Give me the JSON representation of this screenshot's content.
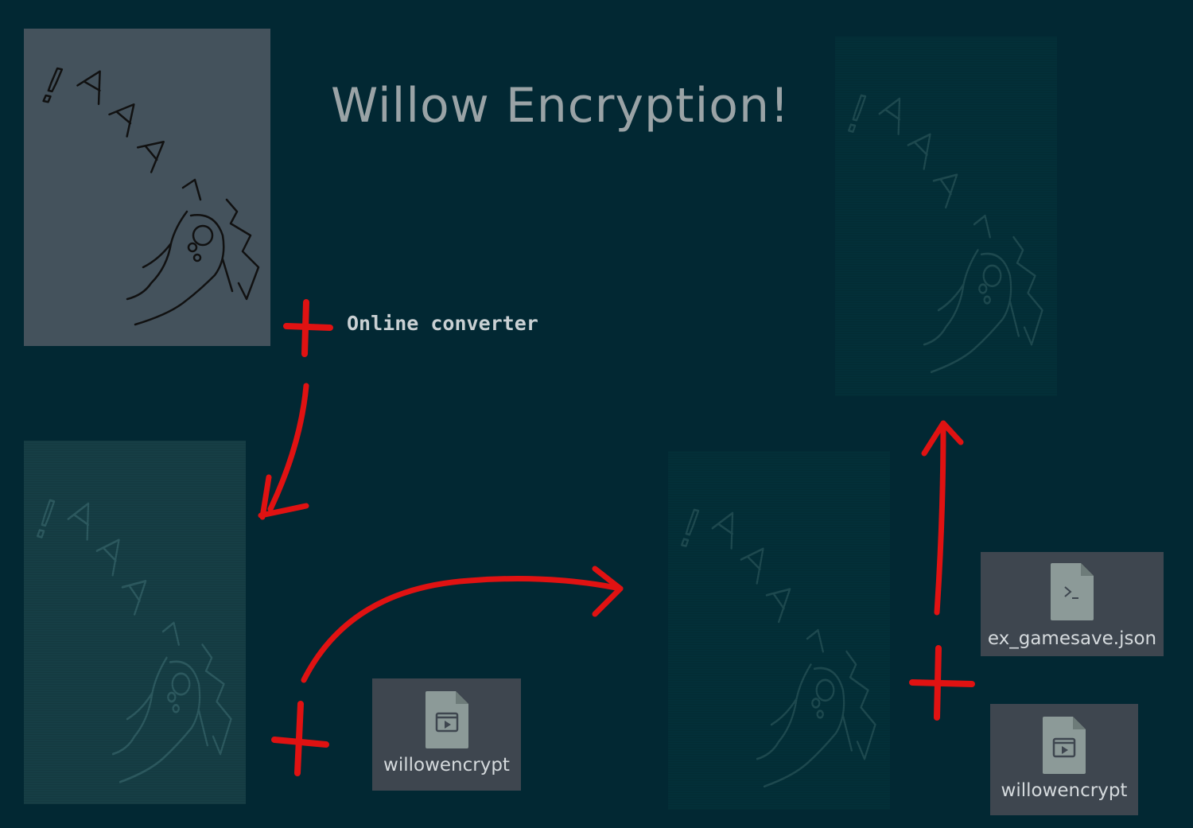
{
  "title": "Willow Encryption!",
  "converter_label": "Online converter",
  "doodle_text": "!AAA",
  "files": {
    "willowencrypt_1": {
      "name": "willowencrypt",
      "icon": "executable-file-icon"
    },
    "gamesave": {
      "name": "ex_gamesave.json",
      "icon": "terminal-script-file-icon"
    },
    "willowencrypt_2": {
      "name": "willowencrypt",
      "icon": "executable-file-icon"
    }
  },
  "colors": {
    "background": "#022833",
    "arrow": "#e01212",
    "file_tile": "#3e464f",
    "title": "#9aa3a6"
  }
}
